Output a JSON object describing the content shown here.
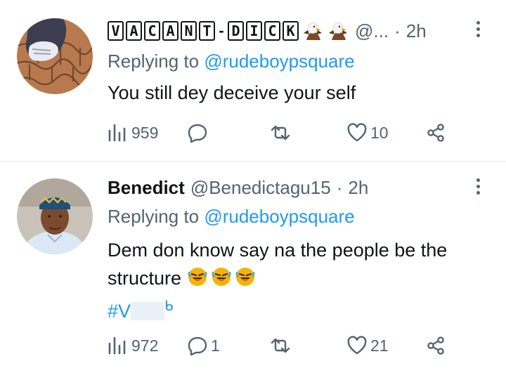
{
  "colors": {
    "accent": "#1d9bf0",
    "muted": "#536471",
    "text": "#0f1419",
    "divider": "#eff3f4"
  },
  "tweets": [
    {
      "display_name_chars": [
        "V",
        "A",
        "C",
        "A",
        "N",
        "T",
        "-",
        "D",
        "I",
        "C",
        "K"
      ],
      "display_emojis": [
        "eagle-icon",
        "eagle-icon"
      ],
      "handle": "@...",
      "dot": "·",
      "time": "2h",
      "replying_prefix": "Replying to",
      "replying_handle": "@rudeboypsquare",
      "text": "You still dey deceive your self",
      "actions": {
        "views": "959",
        "replies": "",
        "retweets": "",
        "likes": "10"
      }
    },
    {
      "display_name": "Benedict",
      "handle": "@Benedictagu15",
      "dot": "·",
      "time": "2h",
      "replying_prefix": "Replying to",
      "replying_handle": "@rudeboypsquare",
      "text": "Dem don know say na the people be the structure",
      "emojis": [
        "rolling-laughing-emoji",
        "rolling-laughing-emoji",
        "rolling-laughing-emoji"
      ],
      "hashtag": "#V",
      "hashtag_tail": "ᑲ",
      "actions": {
        "views": "972",
        "replies": "1",
        "retweets": "",
        "likes": "21"
      }
    }
  ]
}
